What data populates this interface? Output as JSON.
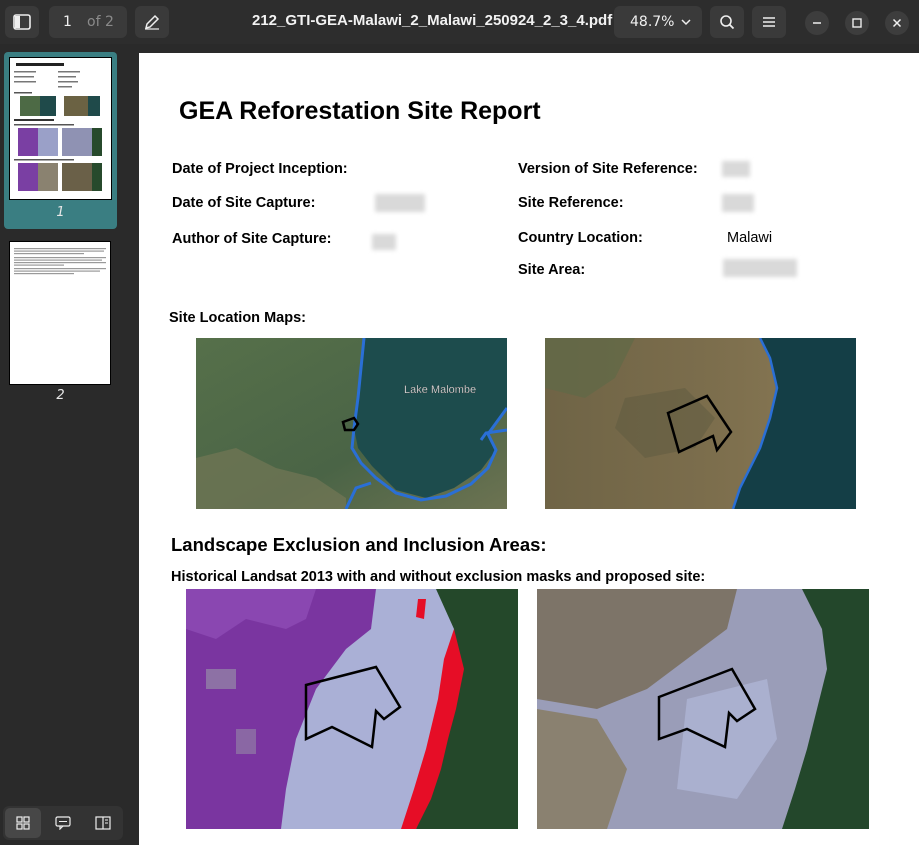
{
  "toolbar": {
    "current_page": "1",
    "page_of": "of 2",
    "document_title": "212_GTI-GEA-Malawi_2_Malawi_250924_2_3_4.pdf",
    "zoom": "48.7%"
  },
  "sidebar": {
    "thumbnails": [
      {
        "label": "1",
        "selected": true
      },
      {
        "label": "2",
        "selected": false
      }
    ],
    "accent_color": "#3a7e82"
  },
  "report": {
    "title": "GEA Reforestation Site Report",
    "fields_left": [
      {
        "label": "Date of Project Inception:",
        "value": ""
      },
      {
        "label": "Date of Site Capture:",
        "value": ""
      },
      {
        "label": "Author of Site Capture:",
        "value": ""
      }
    ],
    "fields_right": [
      {
        "label": "Version of Site Reference:",
        "value": ""
      },
      {
        "label": "Site Reference:",
        "value": ""
      },
      {
        "label": "Country Location:",
        "value": "Malawi"
      },
      {
        "label": "Site Area:",
        "value": ""
      }
    ],
    "site_location_heading": "Site Location Maps:",
    "map_label": "Lake Malombe",
    "landscape_heading": "Landscape Exclusion and Inclusion Areas:",
    "landsat_heading": "Historical Landsat 2013 with and without exclusion masks and proposed site:"
  }
}
